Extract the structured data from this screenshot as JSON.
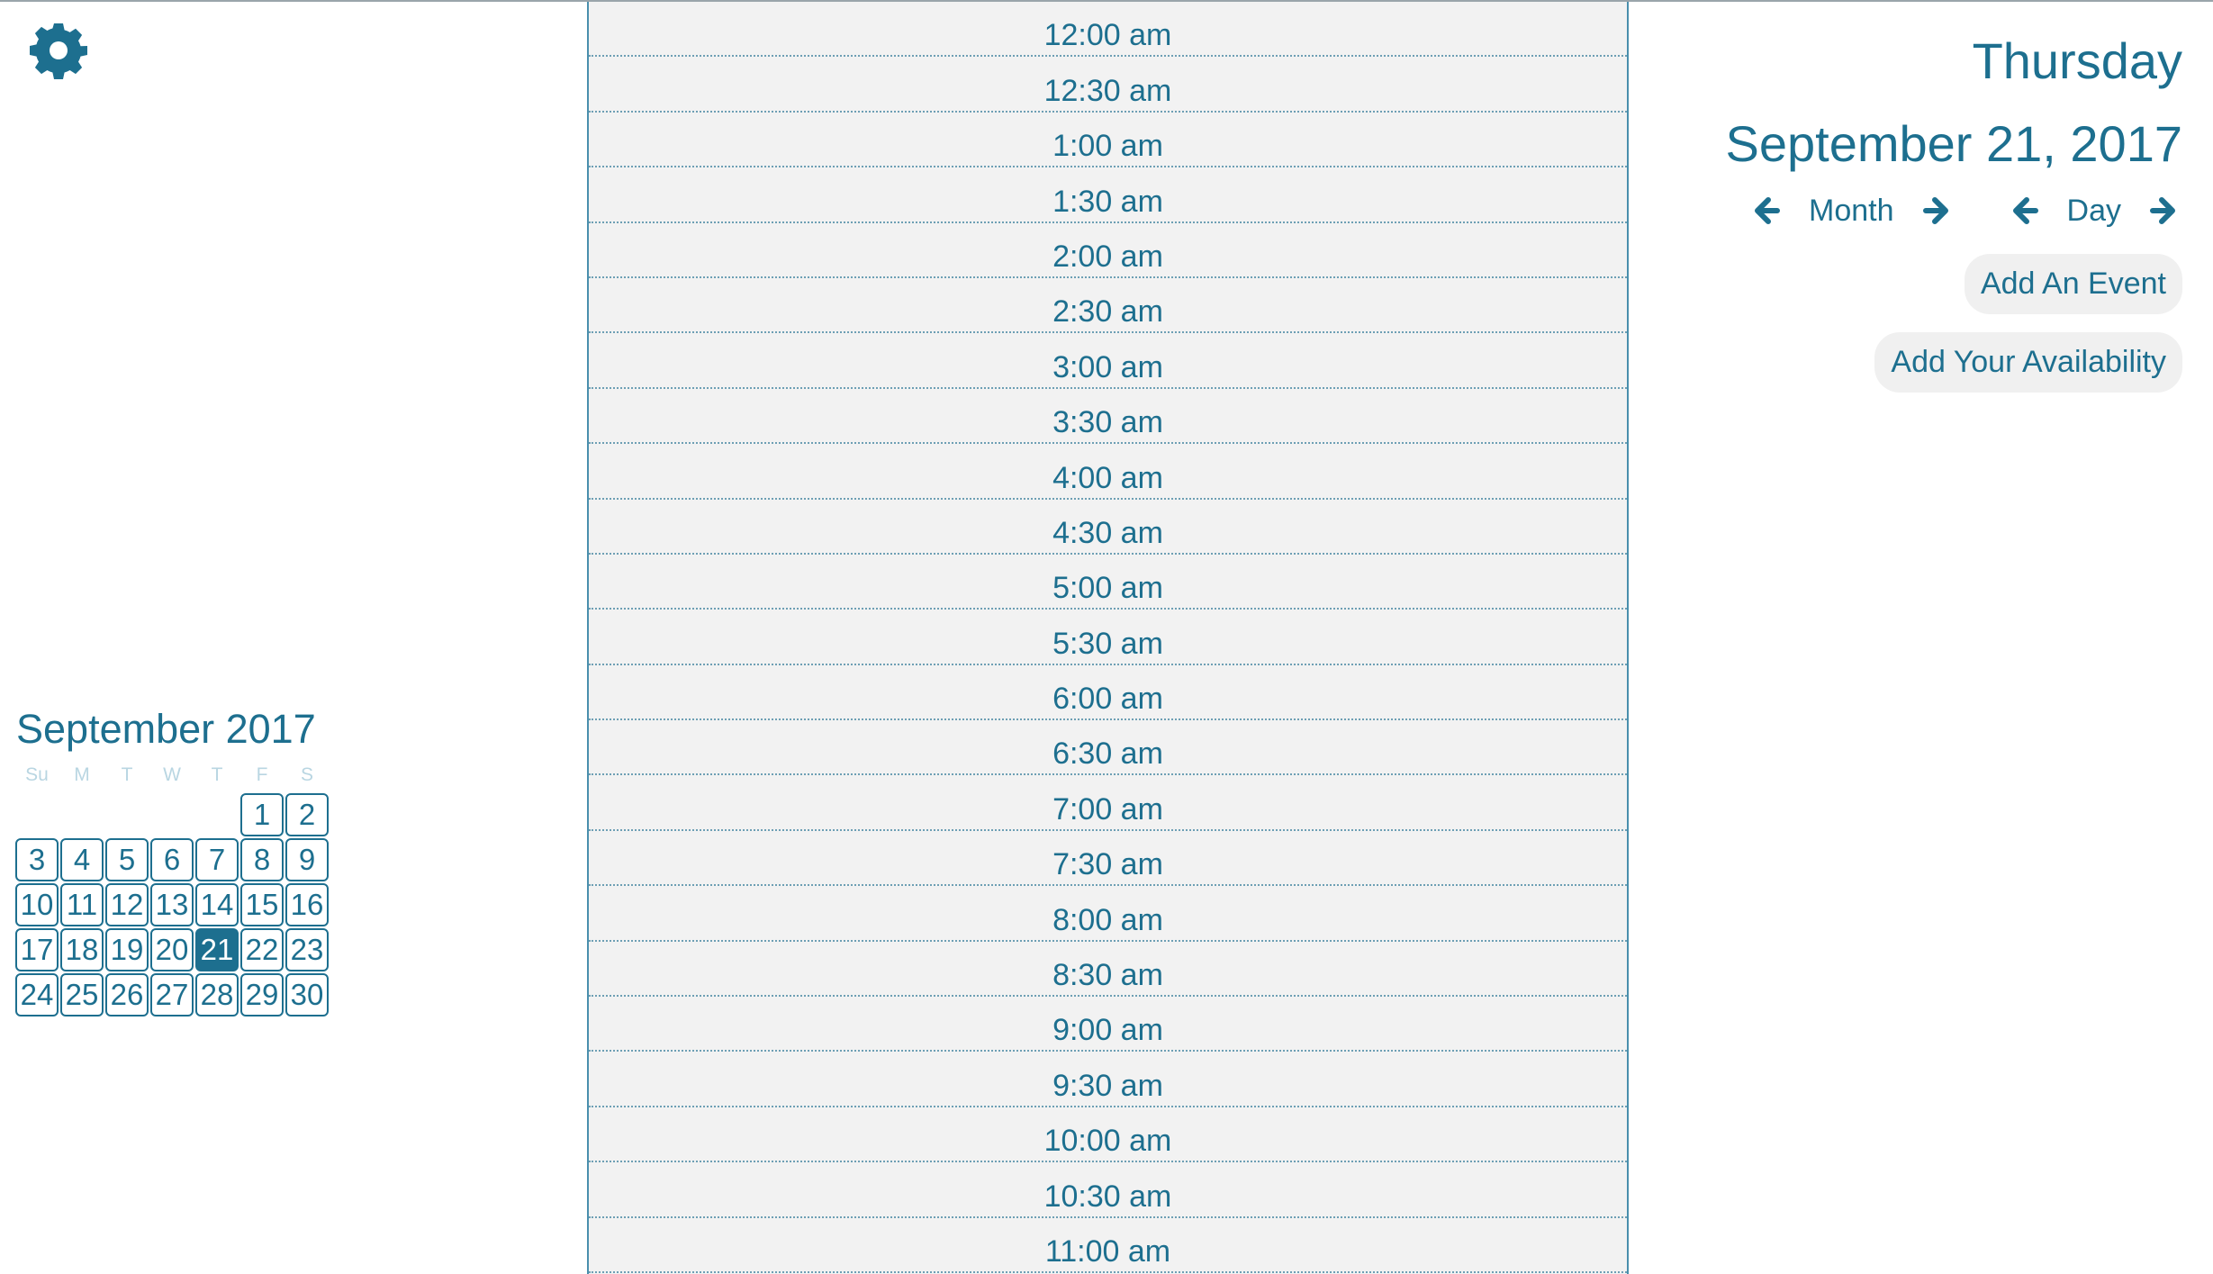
{
  "settings": {
    "icon": "gear-icon"
  },
  "mini_calendar": {
    "title": "September 2017",
    "day_headers": [
      "Su",
      "M",
      "T",
      "W",
      "T",
      "F",
      "S"
    ],
    "leading_blanks": 5,
    "days": [
      "1",
      "2",
      "3",
      "4",
      "5",
      "6",
      "7",
      "8",
      "9",
      "10",
      "11",
      "12",
      "13",
      "14",
      "15",
      "16",
      "17",
      "18",
      "19",
      "20",
      "21",
      "22",
      "23",
      "24",
      "25",
      "26",
      "27",
      "28",
      "29",
      "30"
    ],
    "selected_day": "21"
  },
  "timeline": {
    "slots": [
      "12:00 am",
      "12:30 am",
      "1:00 am",
      "1:30 am",
      "2:00 am",
      "2:30 am",
      "3:00 am",
      "3:30 am",
      "4:00 am",
      "4:30 am",
      "5:00 am",
      "5:30 am",
      "6:00 am",
      "6:30 am",
      "7:00 am",
      "7:30 am",
      "8:00 am",
      "8:30 am",
      "9:00 am",
      "9:30 am",
      "10:00 am",
      "10:30 am",
      "11:00 am"
    ]
  },
  "header": {
    "weekday": "Thursday",
    "date": "September 21, 2017",
    "month_label": "Month",
    "day_label": "Day"
  },
  "actions": {
    "add_event": "Add An Event",
    "add_availability": "Add Your Availability"
  },
  "colors": {
    "accent": "#1d6f8f",
    "timeline_bg": "#f2f2f2",
    "button_bg": "#f0f0f0"
  }
}
